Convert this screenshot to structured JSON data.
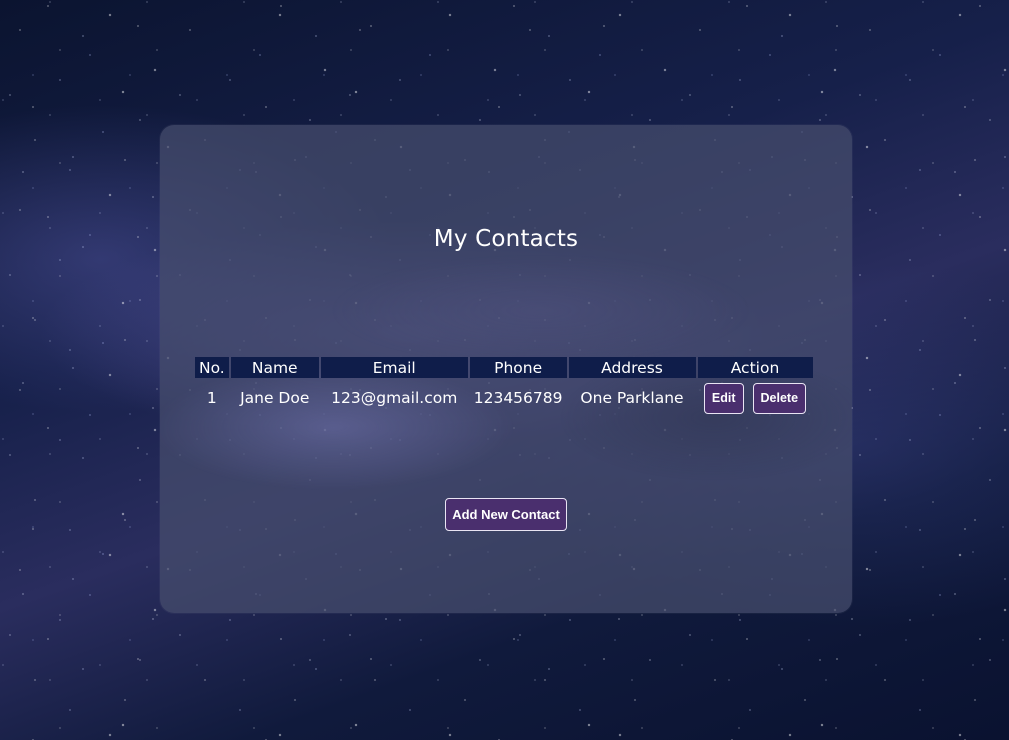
{
  "page": {
    "title": "My Contacts"
  },
  "table": {
    "headers": [
      "No.",
      "Name",
      "Email",
      "Phone",
      "Address",
      "Action"
    ],
    "rows": [
      {
        "no": "1",
        "name": "Jane Doe",
        "email": "123@gmail.com",
        "phone": "123456789",
        "address": "One Parklane",
        "edit_label": "Edit",
        "delete_label": "Delete"
      }
    ]
  },
  "actions": {
    "add_label": "Add New Contact"
  },
  "colors": {
    "header_bg": "#0f1d4a",
    "button_bg": "#4a2f6e",
    "button_border": "#e9e4f3",
    "card_bg": "rgba(70, 78, 110, 0.72)"
  }
}
